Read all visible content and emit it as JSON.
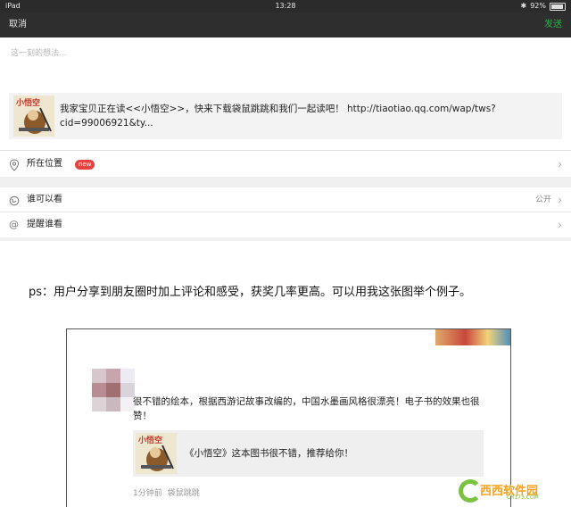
{
  "status_bar": {
    "device": "iPad",
    "time": "13:28",
    "battery": "92%",
    "battery_level": 0.92
  },
  "nav": {
    "cancel": "取消",
    "send": "发送"
  },
  "compose": {
    "placeholder": "这一刻的想法..."
  },
  "share_card": {
    "thumb_title": "小悟空",
    "text": "我家宝贝正在读<<小悟空>>，快来下载袋鼠跳跳和我们一起读吧！ http://tiaotiao.qq.com/wap/tws?cid=99006921&ty..."
  },
  "rows": {
    "location": {
      "label": "所在位置",
      "badge": "new"
    },
    "visibility": {
      "label": "谁可以看",
      "value": "公开"
    },
    "mention": {
      "label": "提醒谁看"
    }
  },
  "caption": "ps：用户分享到朋友圈时加上评论和感受，获奖几率更高。可以用我这张图举个例子。",
  "example_post": {
    "text": "很不错的绘本，根据西游记故事改编的，中国水墨画风格很漂亮！电子书的效果也很赞！",
    "link_thumb_title": "小悟空",
    "link_text": "《小悟空》这本图书很不错，推荐给你！",
    "time": "1分钟前",
    "source": "袋鼠跳跳"
  },
  "watermark": {
    "text": "西西软件园",
    "sub": "CR173.COM"
  },
  "colors": {
    "nav_bg": "#2e2e2e",
    "send_green": "#2bb24c",
    "badge_red": "#e64340"
  }
}
